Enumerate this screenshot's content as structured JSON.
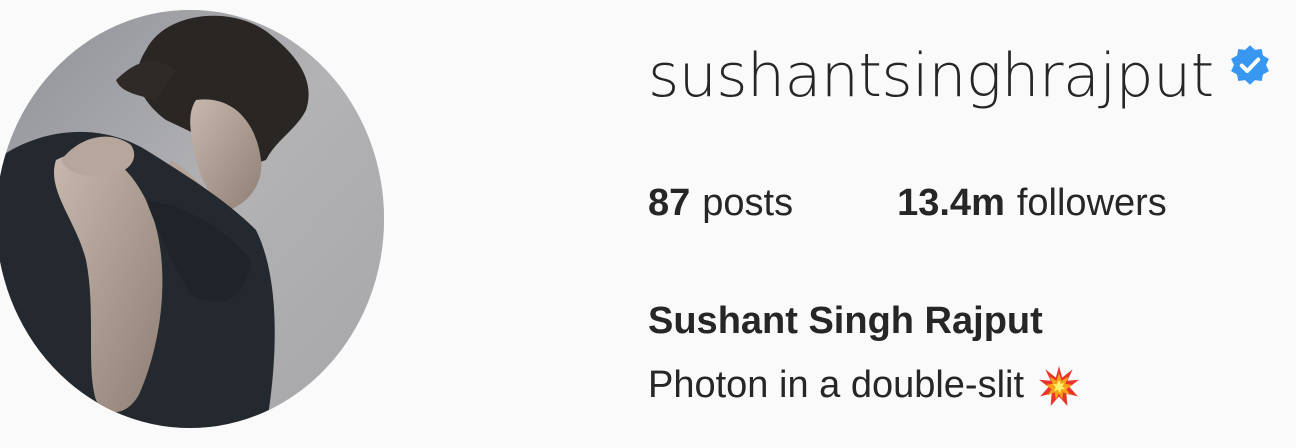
{
  "profile": {
    "username": "sushantsinghrajput",
    "verified_icon": "verified-badge-icon",
    "stats": {
      "posts_count": "87",
      "posts_label": "posts",
      "followers_count": "13.4m",
      "followers_label": "followers"
    },
    "full_name": "Sushant Singh Rajput",
    "bio": "Photon in a double-slit",
    "bio_icon": "collision-emoji-icon"
  },
  "colors": {
    "background": "#fafafa",
    "text": "#262626",
    "verified_blue": "#3897f0"
  }
}
